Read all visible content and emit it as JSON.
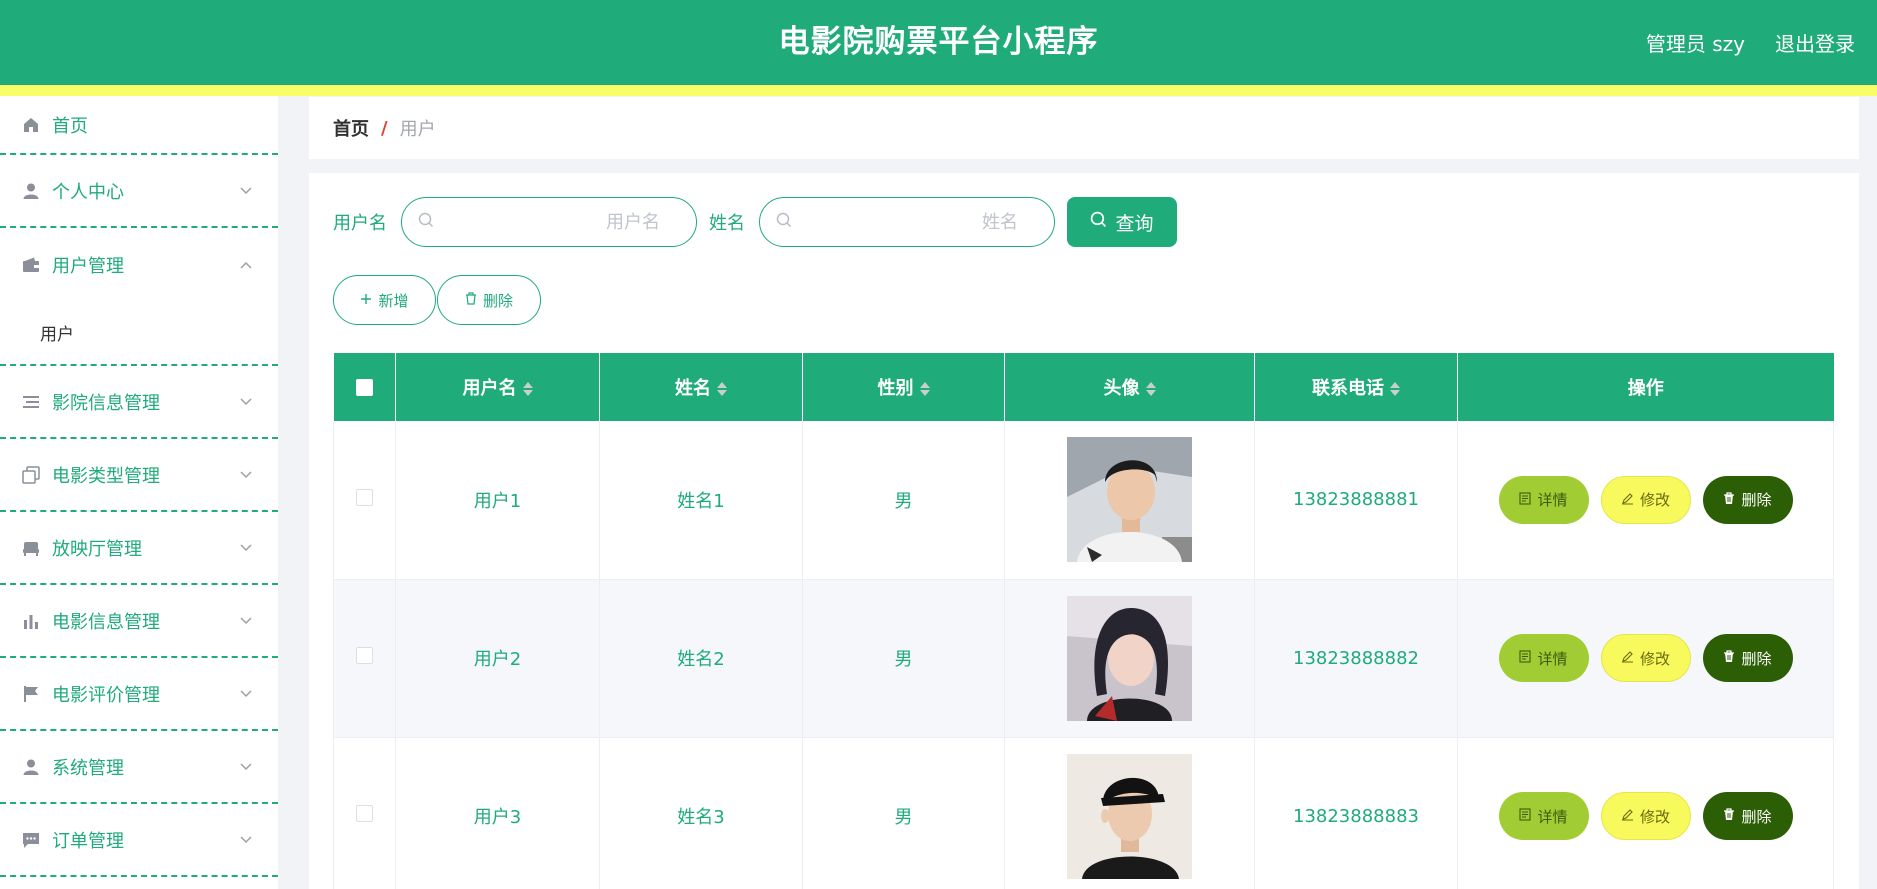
{
  "header": {
    "title": "电影院购票平台小程序",
    "user": "管理员 szy",
    "logout": "退出登录"
  },
  "sidebar": {
    "items": [
      {
        "label": "首页",
        "icon": "home-icon"
      },
      {
        "label": "个人中心",
        "icon": "user-icon"
      },
      {
        "label": "用户管理",
        "icon": "wallet-icon",
        "expanded": true,
        "children": [
          "用户"
        ]
      },
      {
        "label": "影院信息管理",
        "icon": "list-icon"
      },
      {
        "label": "电影类型管理",
        "icon": "copy-icon"
      },
      {
        "label": "放映厅管理",
        "icon": "sofa-icon"
      },
      {
        "label": "电影信息管理",
        "icon": "bar-chart-icon"
      },
      {
        "label": "电影评价管理",
        "icon": "flag-icon"
      },
      {
        "label": "系统管理",
        "icon": "user-icon"
      },
      {
        "label": "订单管理",
        "icon": "chat-icon"
      }
    ]
  },
  "breadcrumb": {
    "home": "首页",
    "separator": "/",
    "current": "用户"
  },
  "search": {
    "username_label": "用户名",
    "username_placeholder": "用户名",
    "name_label": "姓名",
    "name_placeholder": "姓名",
    "query_button": "查询"
  },
  "actions": {
    "add": "新增",
    "delete": "删除"
  },
  "table": {
    "columns": [
      "用户名",
      "姓名",
      "性别",
      "头像",
      "联系电话",
      "操作"
    ],
    "rows": [
      {
        "username": "用户1",
        "name": "姓名1",
        "gender": "男",
        "phone": "13823888881"
      },
      {
        "username": "用户2",
        "name": "姓名2",
        "gender": "男",
        "phone": "13823888882"
      },
      {
        "username": "用户3",
        "name": "姓名3",
        "gender": "男",
        "phone": "13823888883"
      }
    ],
    "row_actions": {
      "detail": "详情",
      "edit": "修改",
      "delete": "删除"
    }
  },
  "colors": {
    "primary": "#1fab7a",
    "stripe": "#f9fd68",
    "detail_button": "#a1cc33",
    "edit_button": "#f7f95c",
    "delete_button": "#2b5e05"
  }
}
